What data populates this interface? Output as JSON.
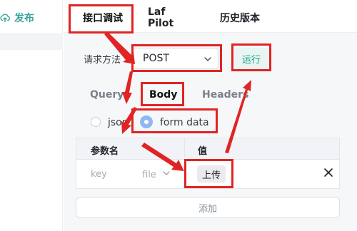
{
  "left": {
    "publish_label": "发布"
  },
  "tabs": [
    {
      "label": "接口调试",
      "active": true
    },
    {
      "label": "Laf Pilot",
      "active": false
    },
    {
      "label": "历史版本",
      "active": false
    }
  ],
  "request": {
    "method_label": "请求方法",
    "method_value": "POST",
    "run_label": "运行"
  },
  "body_tabs": [
    {
      "label": "Query",
      "active": false
    },
    {
      "label": "Body",
      "active": true
    },
    {
      "label": "Headers",
      "active": false
    }
  ],
  "body_types": [
    {
      "label": "json",
      "checked": false
    },
    {
      "label": "form data",
      "checked": true
    }
  ],
  "params_table": {
    "headers": [
      "参数名",
      "值"
    ],
    "row": {
      "key_placeholder": "key",
      "type": "file",
      "upload_label": "上传"
    }
  },
  "add_label": "添加",
  "colors": {
    "accent": "#1b9c86",
    "annotation": "#e02424",
    "radio_checked": "#8fb8f3"
  },
  "icons": [
    "upload-icon",
    "chevron-down-icon",
    "close-icon"
  ]
}
